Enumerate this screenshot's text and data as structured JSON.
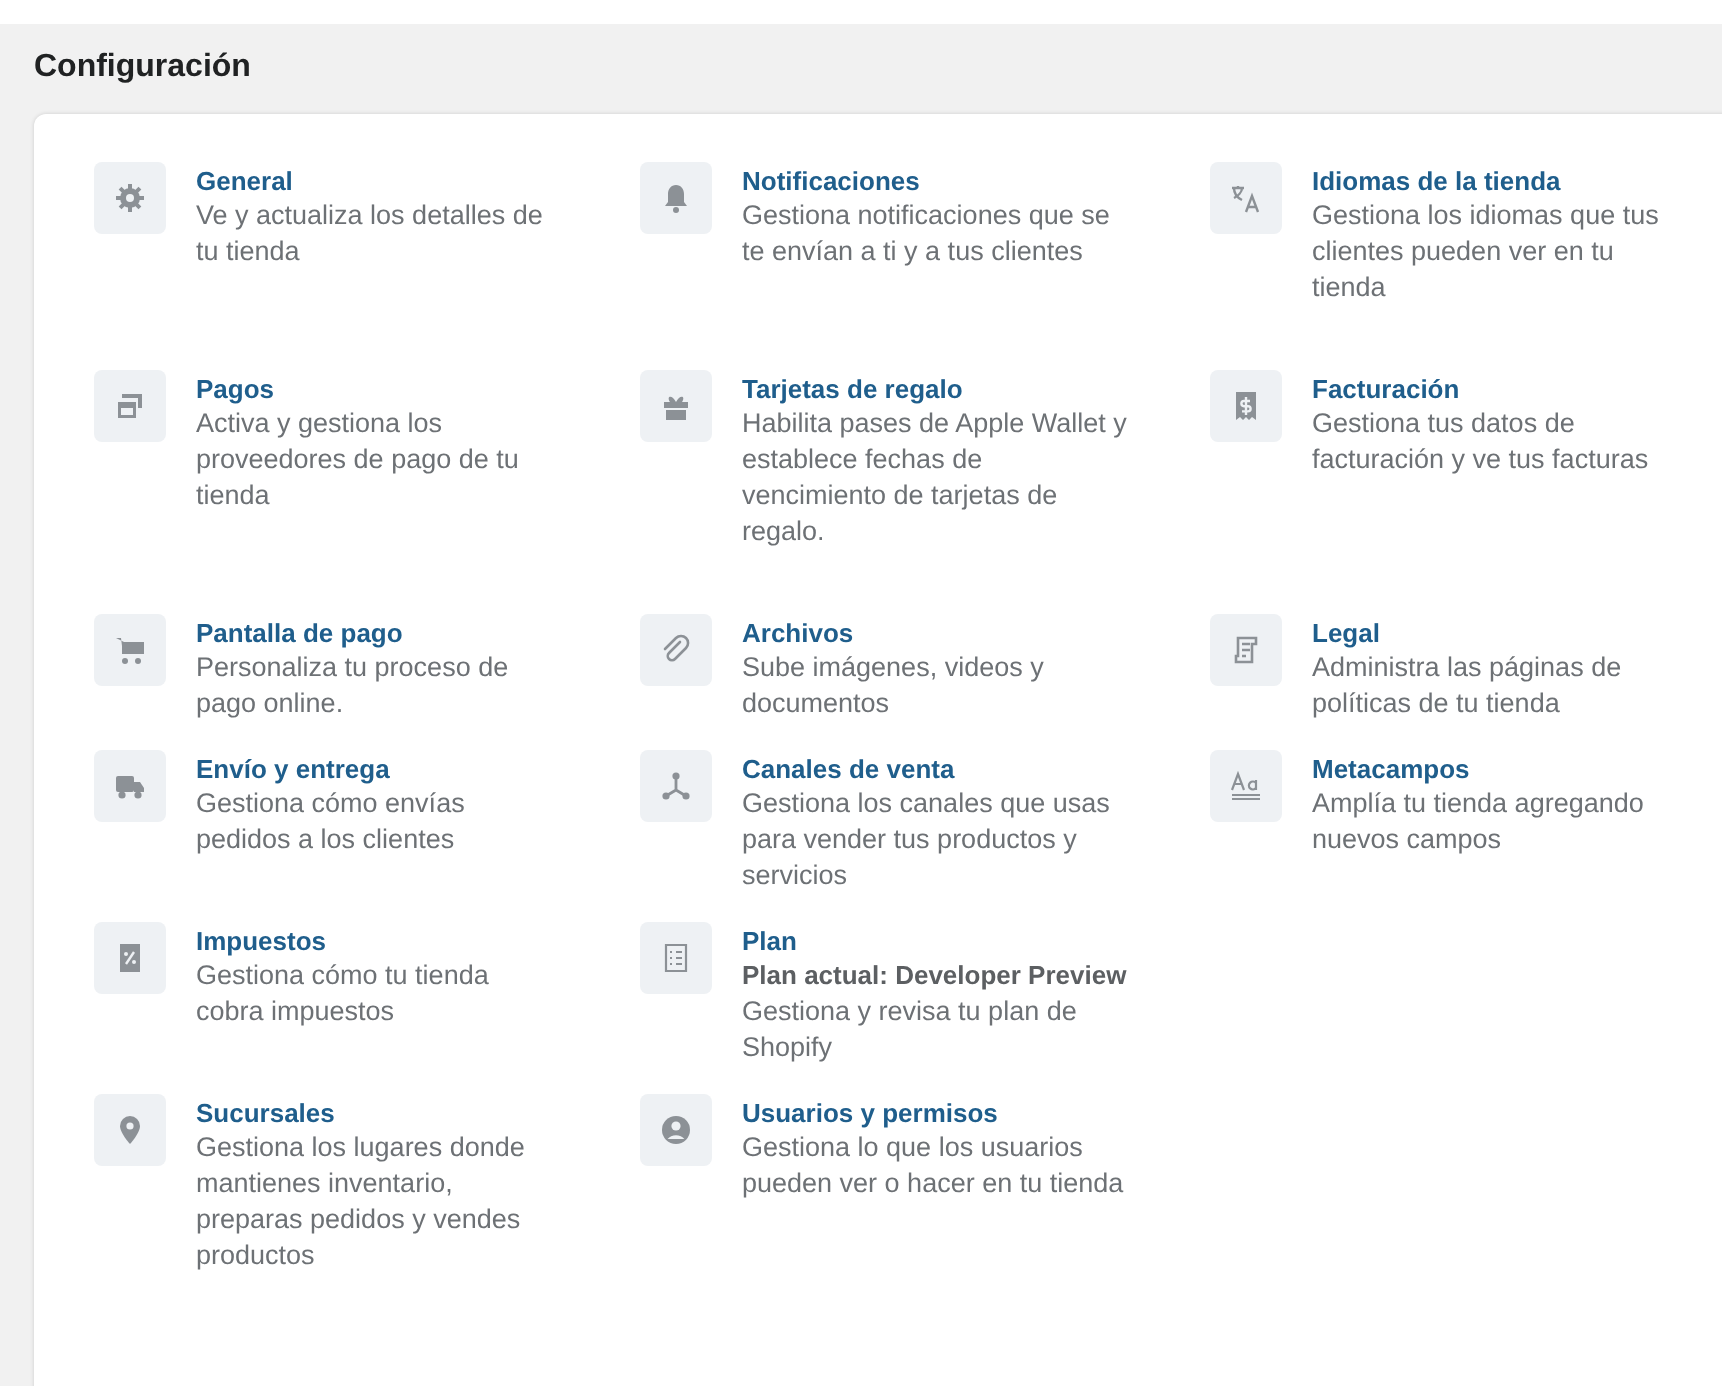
{
  "title": "Configuración",
  "rows": [
    [
      {
        "title": "General",
        "desc": "Ve y actualiza los detalles de\ntu tienda"
      },
      {
        "title": "Notificaciones",
        "desc": "Gestiona notificaciones que se\nte envían a ti y a tus clientes"
      },
      {
        "title": "Idiomas de la tienda",
        "desc": "Gestiona los idiomas que tus\nclientes pueden ver en tu\ntienda"
      }
    ],
    [
      {
        "title": "Pagos",
        "desc": "Activa y gestiona los\nproveedores de pago de tu\ntienda"
      },
      {
        "title": "Tarjetas de regalo",
        "desc": "Habilita pases de Apple Wallet y\nestablece fechas de\nvencimiento de tarjetas de\nregalo."
      },
      {
        "title": "Facturación",
        "desc": "Gestiona tus datos de\nfacturación y ve tus facturas"
      }
    ],
    [
      {
        "title": "Pantalla de pago",
        "desc": "Personaliza tu proceso de\npago online."
      },
      {
        "title": "Archivos",
        "desc": "Sube imágenes, videos y\ndocumentos"
      },
      {
        "title": "Legal",
        "desc": "Administra las páginas de\npolíticas de tu tienda"
      }
    ],
    [
      {
        "title": "Envío y entrega",
        "desc": "Gestiona cómo envías\npedidos a los clientes"
      },
      {
        "title": "Canales de venta",
        "desc": "Gestiona los canales que usas\npara vender tus productos y\nservicios"
      },
      {
        "title": "Metacampos",
        "desc": "Amplía tu tienda agregando\nnuevos campos"
      }
    ],
    [
      {
        "title": "Impuestos",
        "desc": "Gestiona cómo tu tienda\ncobra impuestos"
      },
      {
        "title": "Plan",
        "subtitle": "Plan actual: Developer Preview",
        "desc": "Gestiona y revisa tu plan de\nShopify"
      }
    ],
    [
      {
        "title": "Sucursales",
        "desc": "Gestiona los lugares donde\nmantienes inventario,\npreparas pedidos y vendes\nproductos"
      },
      {
        "title": "Usuarios y permisos",
        "desc": "Gestiona lo que los usuarios\npueden ver o hacer en tu tienda"
      }
    ]
  ]
}
